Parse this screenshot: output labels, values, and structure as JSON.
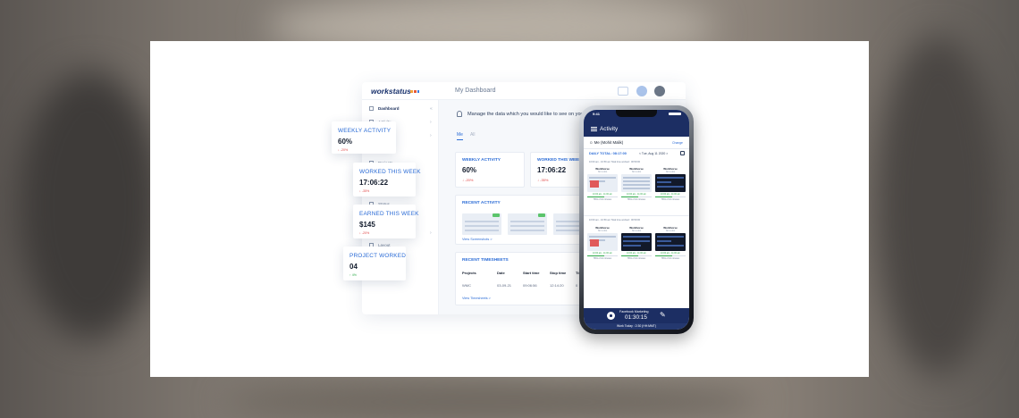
{
  "brand": {
    "logo": "workstatus",
    "accent": "#2a6bd6",
    "navy": "#1c2e63"
  },
  "dashboard": {
    "page_title": "My Dashboard",
    "sidebar": [
      {
        "label": "Dashboard",
        "icon": "grid-icon",
        "active": true
      },
      {
        "label": "Activity",
        "icon": "activity-icon"
      },
      {
        "label": "Projects",
        "icon": "folder-icon"
      },
      {
        "label": "Status",
        "icon": "status-icon"
      },
      {
        "label": "Layout",
        "icon": "layout-icon"
      }
    ],
    "tip": "Manage the data which you would like to see on your",
    "tabs": [
      "Me",
      "All"
    ],
    "weekly_activity": {
      "label": "WEEKLY ACTIVITY",
      "value": "60%",
      "delta": "↓ -20%"
    },
    "worked_this_week": {
      "label": "WORKED THIS WEEK",
      "value": "17:06:22",
      "delta": "↓ -35%"
    },
    "recent_activity": {
      "label": "RECENT ACTIVITY",
      "link": "View Screenshots >"
    },
    "recent_timesheets": {
      "label": "RECENT TIMESHEETS",
      "columns": [
        "Projects",
        "Date",
        "Start time",
        "Stop time",
        "Tim"
      ],
      "rows": [
        [
          "WMC",
          "03-09-21",
          "09:06:56",
          "12:14:20",
          "0"
        ]
      ],
      "link": "View Timesheets >"
    }
  },
  "floating_cards": [
    {
      "label": "WEEKLY ACTIVITY",
      "value": "60%",
      "delta": "↓ -20%"
    },
    {
      "label": "WORKED THIS WEEK",
      "value": "17:06:22",
      "delta": "↓ -35%"
    },
    {
      "label": "EARNED THIS WEEK",
      "value": "$145",
      "delta": "↓ -20%"
    },
    {
      "label": "PROJECT WORKED",
      "value": "04",
      "delta": "↑ 4%"
    }
  ],
  "phone": {
    "status_time": "9:41",
    "title": "Activity",
    "user": "Me (Mohit Malik)",
    "change": "Change",
    "daily_total": "DAILY TOTAL: 08:17:00",
    "date": "<  Tue, Aug 11 2020  >",
    "slot1": "10:00 am - 10:59 am   Total time worked : 00:59:00",
    "slot2": "10:00 am - 10:59 am   Total time worked : 00:59:00",
    "shots": [
      {
        "title": "Workhorse",
        "sub": "No to-dos",
        "time": "10:00 am - 11:00 am",
        "activity": "55% of 10 minutes"
      },
      {
        "title": "Workhorse",
        "sub": "No to-dos",
        "time": "10:00 am - 11:00 am",
        "activity": "55% of 10 minutes"
      },
      {
        "title": "Workhorse",
        "sub": "No to-dos",
        "time": "10:00 am - 11:00 am",
        "activity": "55% of 10 minutes"
      }
    ],
    "timer_task": "Facebook Marketing",
    "timer_time": "01:30:15",
    "work_today": "Work Today : 2:30 (HH:MMT)"
  }
}
